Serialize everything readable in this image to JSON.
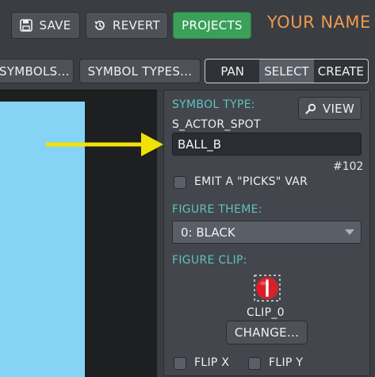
{
  "topbar": {
    "save_label": "SAVE",
    "revert_label": "REVERT",
    "projects_label": "PROJECTS",
    "user_name": "YOUR NAME"
  },
  "toolbar": {
    "symbols_label": "SYMBOLS...",
    "symbol_types_label": "SYMBOL TYPES...",
    "modes": [
      "PAN",
      "SELECT",
      "CREATE"
    ],
    "active_mode": "SELECT"
  },
  "panel": {
    "symbol_type_label": "SYMBOL TYPE:",
    "view_label": "VIEW",
    "symbol_type_value": "S_ACTOR_SPOT",
    "name_value": "BALL_B",
    "index_text": "#102",
    "emit_picks_label": "EMIT A \"PICKS\" VAR",
    "emit_picks_checked": false,
    "figure_theme_label": "FIGURE THEME:",
    "figure_theme_value": "0: BLACK",
    "figure_clip_label": "FIGURE CLIP:",
    "clip_name": "CLIP_0",
    "change_label": "CHANGE...",
    "flip_x_label": "FLIP X",
    "flip_x_checked": false,
    "flip_y_label": "FLIP Y",
    "flip_y_checked": false
  },
  "colors": {
    "accent_green": "#3aa05a",
    "user_name": "#ee9a50",
    "label_teal": "#5fc3bd",
    "canvas_sky": "#85d4f5",
    "arrow_yellow": "#f2e205"
  },
  "icons": {
    "save": "floppy-disk-icon",
    "revert": "history-icon",
    "view": "magnifier-icon",
    "clip": "red-ball-icon",
    "pointer": "yellow-arrow"
  }
}
